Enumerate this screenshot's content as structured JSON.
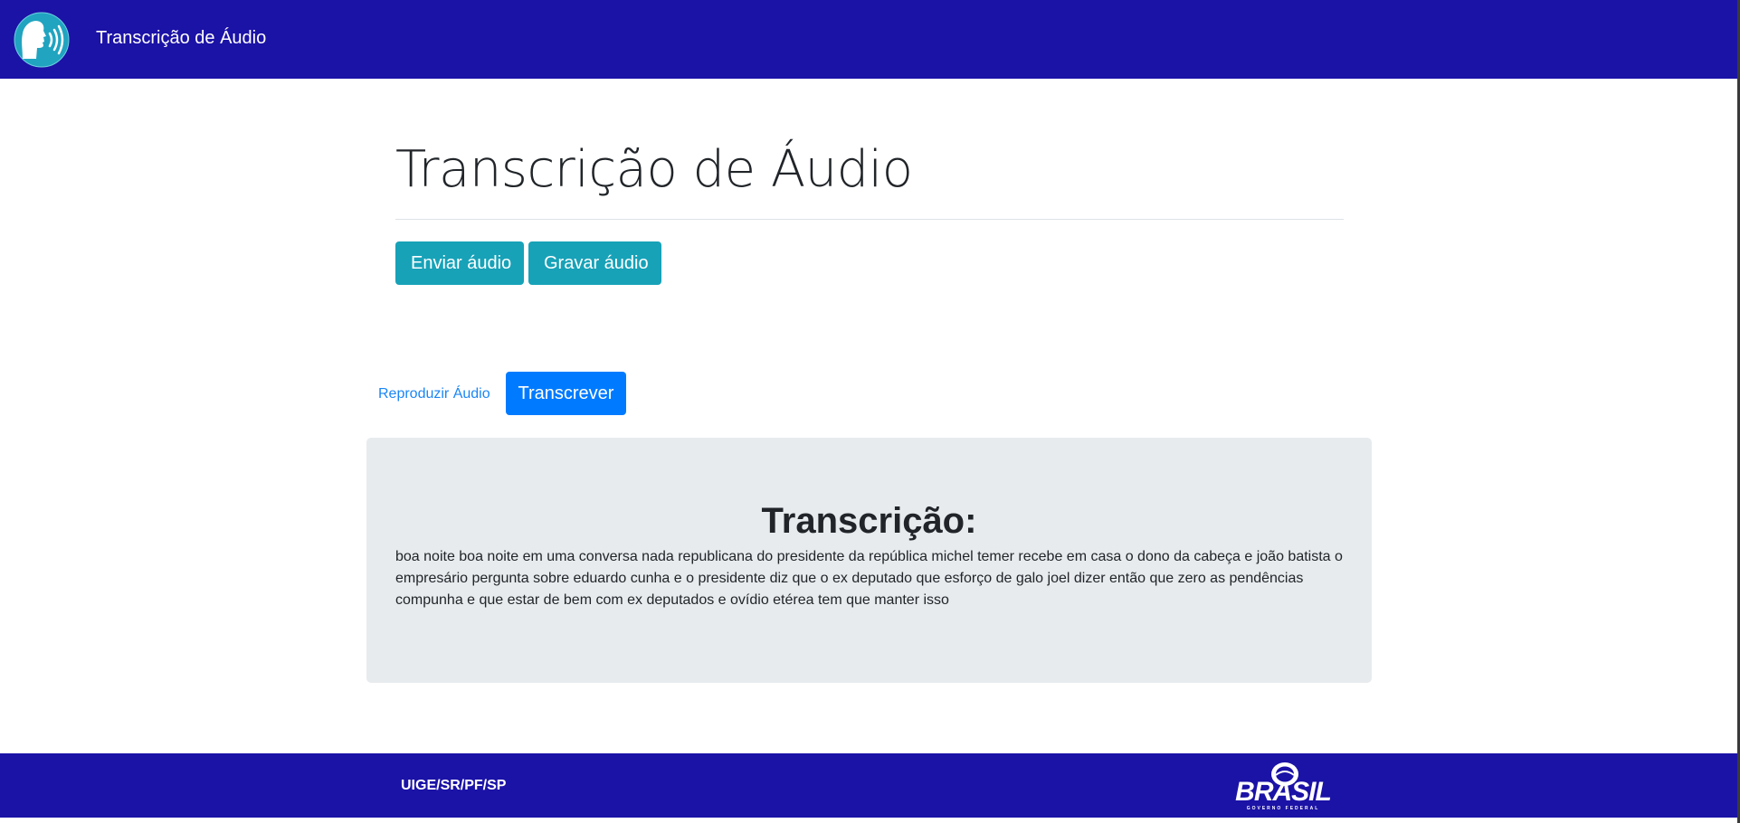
{
  "navbar": {
    "logo_icon": "speaking-head-sound-icon",
    "title": "Transcrição de Áudio"
  },
  "main": {
    "title": "Transcrição de Áudio",
    "buttons": {
      "send_audio": "Enviar áudio",
      "record_audio": "Gravar áudio"
    },
    "play_audio_link": "Reproduzir Áudio",
    "transcribe_button": "Transcrever"
  },
  "transcription": {
    "heading": "Transcrição:",
    "text": "boa noite boa noite em uma conversa nada republicana do presidente da república michel temer recebe em casa o dono da cabeça e joão batista o empresário pergunta sobre eduardo cunha e o presidente diz que o ex deputado que esforço de galo joel dizer então que zero as pendências compunha e que estar de bem com ex deputados e ovídio etérea tem que manter isso"
  },
  "footer": {
    "org": "UIGE/SR/PF/SP",
    "logo_text": "BRASIL",
    "logo_subtext": "GOVERNO FEDERAL"
  },
  "colors": {
    "brand_navy": "#1b12a6",
    "info": "#17a2b8",
    "primary": "#007bff",
    "jumbotron_bg": "#e8ebee"
  }
}
